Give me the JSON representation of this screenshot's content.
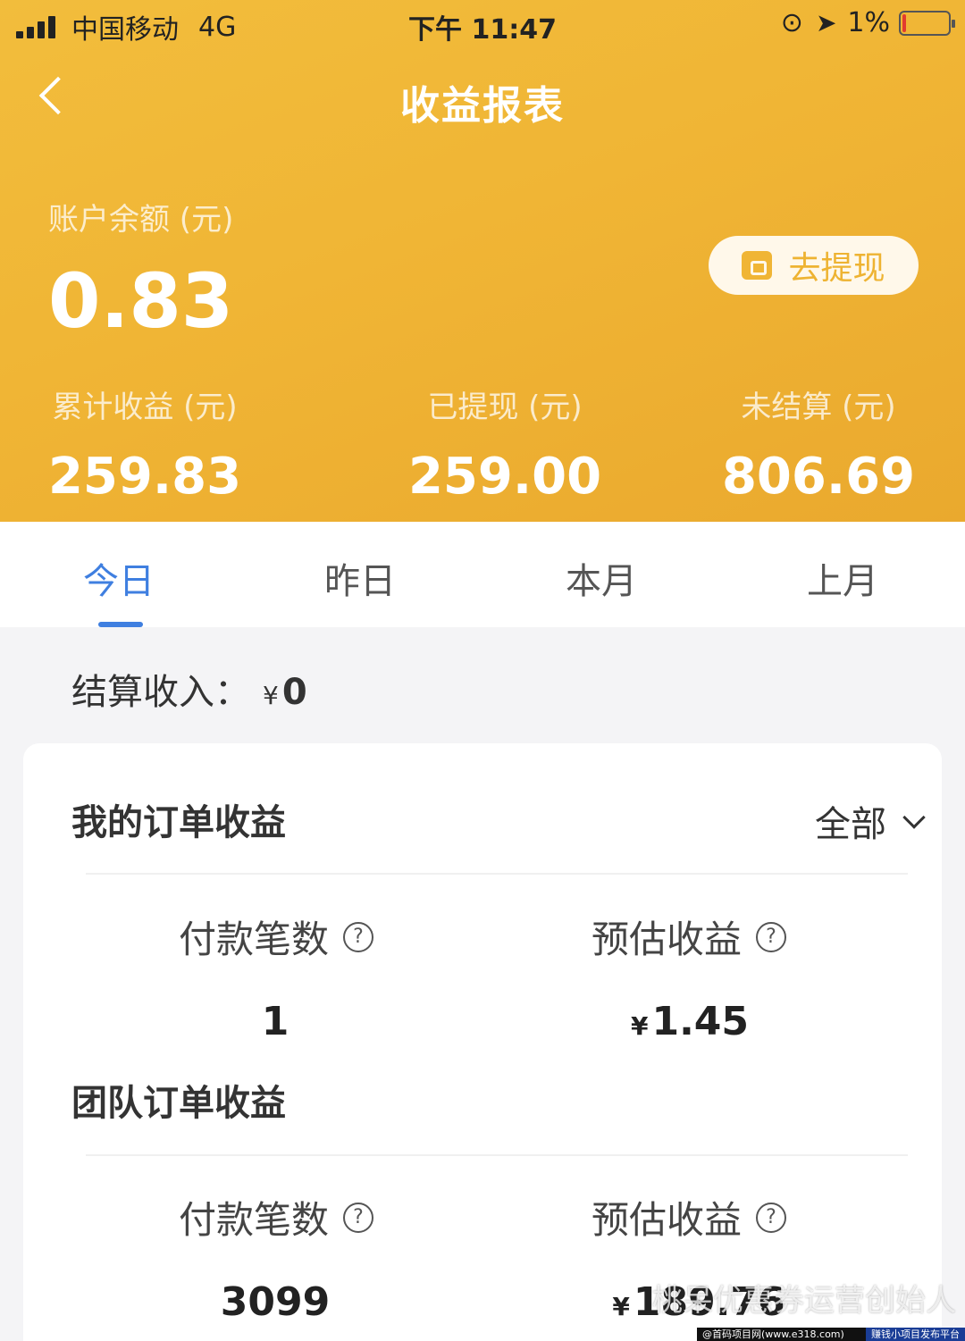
{
  "status_bar": {
    "carrier": "中国移动",
    "network": "4G",
    "time": "下午 11:47",
    "battery": "1%"
  },
  "nav": {
    "title": "收益报表"
  },
  "balance": {
    "label": "账户余额 (元)",
    "value": "0.83",
    "withdraw_label": "去提现"
  },
  "stats": [
    {
      "label": "累计收益 (元)",
      "value": "259.83"
    },
    {
      "label": "已提现 (元)",
      "value": "259.00"
    },
    {
      "label": "未结算 (元)",
      "value": "806.69"
    }
  ],
  "tabs": [
    {
      "label": "今日",
      "active": true
    },
    {
      "label": "昨日",
      "active": false
    },
    {
      "label": "本月",
      "active": false
    },
    {
      "label": "上月",
      "active": false
    }
  ],
  "settlement": {
    "label": "结算收入：",
    "currency": "¥",
    "amount": "0"
  },
  "my_orders": {
    "title": "我的订单收益",
    "filter": "全部",
    "count_label": "付款笔数",
    "count_value": "1",
    "earnings_label": "预估收益",
    "earnings_currency": "¥",
    "earnings_value": "1.45"
  },
  "team_orders": {
    "title": "团队订单收益",
    "count_label": "付款笔数",
    "count_value": "3099",
    "earnings_label": "预估收益",
    "earnings_currency": "¥",
    "earnings_value": "189.76"
  },
  "watermark": "桃呆优惠券运营创始人",
  "footer": {
    "left": "@首码项目网(www.e318.com)",
    "right": "赚钱小项目发布平台"
  },
  "colors": {
    "header_gold": "#f0b535",
    "tab_active": "#3f7fe0"
  },
  "icons": {
    "help": "?"
  }
}
